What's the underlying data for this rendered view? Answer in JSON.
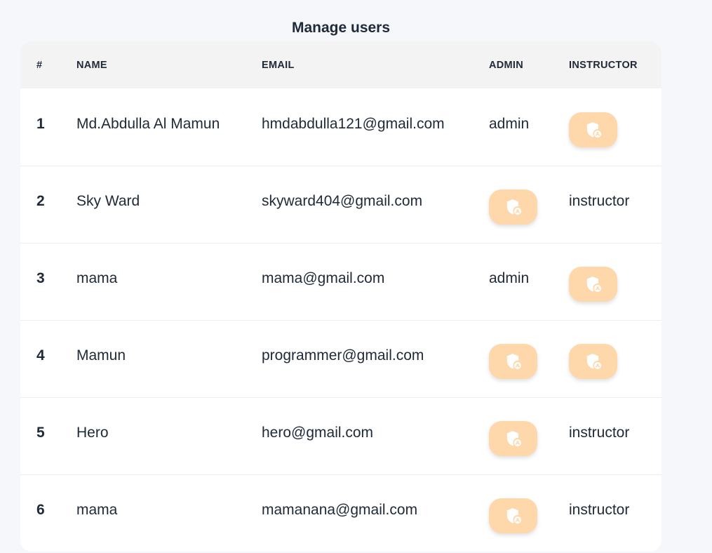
{
  "page": {
    "title": "Manage users"
  },
  "table": {
    "headers": {
      "num": "#",
      "name": "NAME",
      "email": "EMAIL",
      "admin": "ADMIN",
      "instructor": "INSTRUCTOR"
    },
    "rows": [
      {
        "num": "1",
        "name": "Md.Abdulla Al Mamun",
        "email": "hmdabdulla121@gmail.com",
        "admin": "admin",
        "instructor": null
      },
      {
        "num": "2",
        "name": "Sky Ward",
        "email": "skyward404@gmail.com",
        "admin": null,
        "instructor": "instructor"
      },
      {
        "num": "3",
        "name": "mama",
        "email": "mama@gmail.com",
        "admin": "admin",
        "instructor": null
      },
      {
        "num": "4",
        "name": "Mamun",
        "email": "programmer@gmail.com",
        "admin": null,
        "instructor": null
      },
      {
        "num": "5",
        "name": "Hero",
        "email": "hero@gmail.com",
        "admin": null,
        "instructor": "instructor"
      },
      {
        "num": "6",
        "name": "mama",
        "email": "mamanana@gmail.com",
        "admin": null,
        "instructor": "instructor"
      }
    ]
  },
  "icons": {
    "role_button": "shield-user-icon"
  },
  "colors": {
    "role_button_bg": "#fed7aa",
    "background": "#f5f7fa",
    "header_bg": "#f3f3f3"
  }
}
